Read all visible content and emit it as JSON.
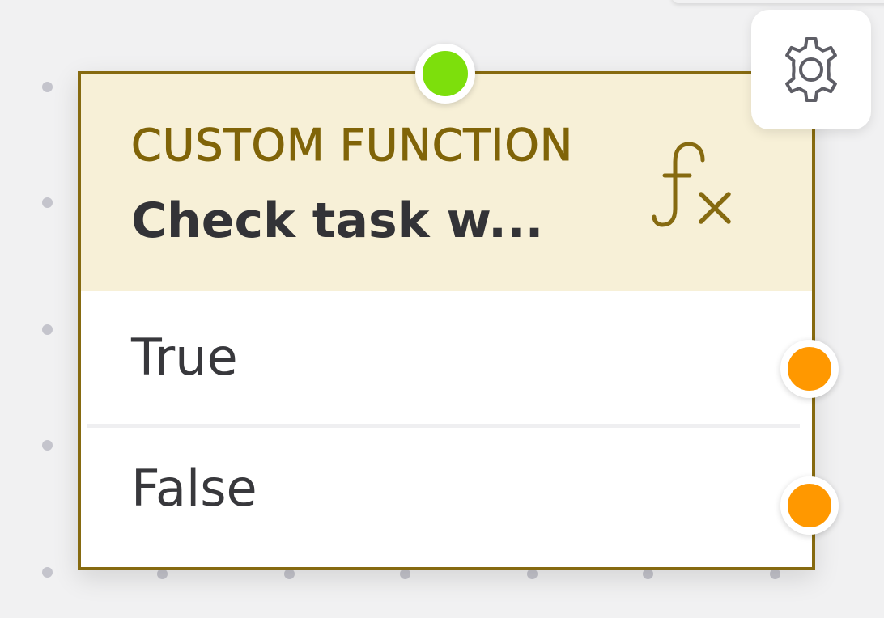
{
  "node": {
    "type_label": "CUSTOM FUNCTION",
    "title": "Check task w...",
    "icon": "function-fx-icon",
    "outcomes": [
      {
        "label": "True"
      },
      {
        "label": "False"
      }
    ]
  },
  "toolbar": {
    "settings_icon": "gear-icon"
  },
  "colors": {
    "node_border": "#866a10",
    "header_background": "#f7f0d7",
    "type_label": "#806408",
    "input_port": "#7ddf0c",
    "output_port": "#ff9800",
    "canvas_background": "#f1f1f2",
    "grid_dot": "#c4c4cc"
  }
}
